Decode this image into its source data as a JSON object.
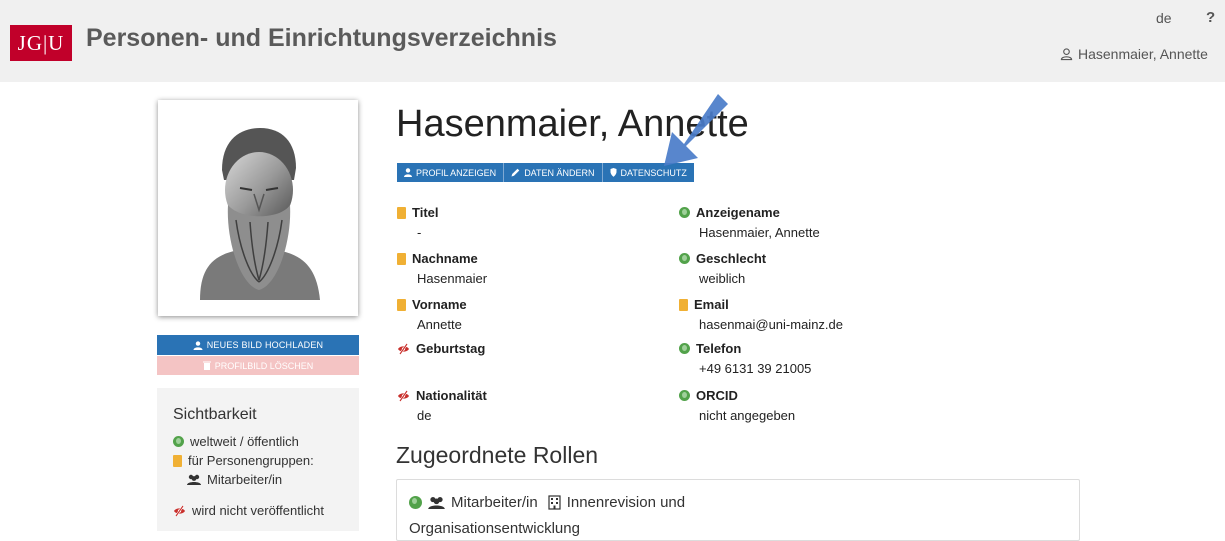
{
  "header": {
    "logo_text": "JG|U",
    "app_title": "Personen- und Einrichtungsverzeichnis",
    "language": "de",
    "help": "?",
    "user_name": "Hasenmaier, Annette"
  },
  "profile": {
    "name": "Hasenmaier, Annette",
    "buttons": {
      "show_profile": "PROFIL ANZEIGEN",
      "edit_data": "DATEN ÄNDERN",
      "privacy": "DATENSCHUTZ"
    }
  },
  "photo_actions": {
    "upload": "NEUES BILD HOCHLADEN",
    "delete": "PROFILBILD LÖSCHEN"
  },
  "visibility": {
    "title": "Sichtbarkeit",
    "public": "weltweit / öffentlich",
    "groups": "für Personengruppen:",
    "group_staff": "Mitarbeiter/in",
    "hidden": "wird nicht veröffentlicht"
  },
  "fields": {
    "titel": {
      "label": "Titel",
      "value": "-"
    },
    "nachname": {
      "label": "Nachname",
      "value": "Hasenmaier"
    },
    "vorname": {
      "label": "Vorname",
      "value": "Annette"
    },
    "geburtstag": {
      "label": "Geburtstag",
      "value": ""
    },
    "nationalitaet": {
      "label": "Nationalität",
      "value": "de"
    },
    "anzeigename": {
      "label": "Anzeigename",
      "value": "Hasenmaier, Annette"
    },
    "geschlecht": {
      "label": "Geschlecht",
      "value": "weiblich"
    },
    "email": {
      "label": "Email",
      "value": "hasenmai@uni-mainz.de"
    },
    "telefon": {
      "label": "Telefon",
      "value": "+49 6131 39 21005"
    },
    "orcid": {
      "label": "ORCID",
      "value": "nicht angegeben"
    }
  },
  "roles": {
    "title": "Zugeordnete Rollen",
    "role": "Mitarbeiter/in",
    "unit_line1": "Innenrevision und",
    "unit_line2": "Organisationsentwicklung"
  },
  "colors": {
    "brand_red": "#c1002a",
    "button_blue": "#2a73b5",
    "public_green": "#52a24a",
    "group_orange": "#f0b034",
    "hidden_red": "#c9302c"
  }
}
